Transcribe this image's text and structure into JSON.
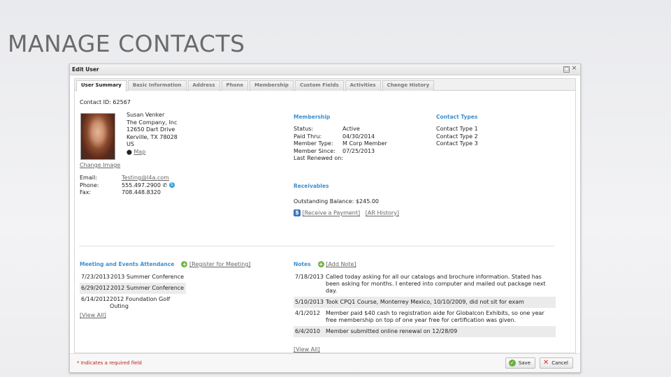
{
  "slide": {
    "title": "MANAGE CONTACTS"
  },
  "window": {
    "title": "Edit User",
    "minimize_glyph": "□",
    "close_glyph": "×"
  },
  "tabs": [
    {
      "label": "User Summary"
    },
    {
      "label": "Basic Information"
    },
    {
      "label": "Address"
    },
    {
      "label": "Phone"
    },
    {
      "label": "Membership"
    },
    {
      "label": "Custom Fields"
    },
    {
      "label": "Activities"
    },
    {
      "label": "Change History"
    }
  ],
  "contact": {
    "id_text": "Contact ID: 62567",
    "name": "Susan Venker",
    "company": "The Company, Inc",
    "street": "12650 Dart Drive",
    "city": "Kerville, TX 78028",
    "country": "US",
    "map_link": "Map",
    "change_image": "Change Image",
    "email_label": "Email:",
    "email": "Testing@l4a.com",
    "phone_label": "Phone:",
    "phone": "555.497.2900",
    "fax_label": "Fax:",
    "fax": "708.448.8320"
  },
  "membership": {
    "heading": "Membership",
    "rows": [
      {
        "label": "Status:",
        "value": "Active"
      },
      {
        "label": "Paid Thru:",
        "value": "04/30/2014"
      },
      {
        "label": "Member Type:",
        "value": "M Corp Member"
      },
      {
        "label": "Member Since:",
        "value": "07/25/2013"
      },
      {
        "label": "Last Renewed on:",
        "value": ""
      }
    ]
  },
  "contact_types": {
    "heading": "Contact Types",
    "items": [
      "Contact Type 1",
      "Contact Type 2",
      "Contact Type 3"
    ]
  },
  "receivables": {
    "heading": "Receivables",
    "balance": "Outstanding Balance: $245.00",
    "receive_payment": "[Receive a Payment]",
    "ar_history": "[AR History]"
  },
  "meetings": {
    "heading": "Meeting and Events Attendance",
    "register_link": "[Register for Meeting]",
    "rows": [
      {
        "date": "7/23/2013",
        "name": "2013 Summer Conference"
      },
      {
        "date": "6/29/2012",
        "name": "2012 Summer Conference"
      },
      {
        "date": "6/14/2012",
        "name": "2012 Foundation Golf Outing"
      }
    ],
    "view_all": "[View All]"
  },
  "notes": {
    "heading": "Notes",
    "add_link": "[Add Note]",
    "rows": [
      {
        "date": "7/18/2013",
        "text": "Called today asking for all our catalogs and brochure information. Stated has been asking for months. I entered into computer and mailed out package next day."
      },
      {
        "date": "5/10/2013",
        "text": "Took CPQ1 Course, Monterrey Mexico, 10/10/2009, did not sit for exam"
      },
      {
        "date": "4/1/2012",
        "text": "Member paid $40 cash to registration aide for Globalcon Exhibits, so one year free membership on top of one year free for certification was given."
      },
      {
        "date": "6/4/2010",
        "text": "Member submitted online renewal on 12/28/09"
      }
    ],
    "view_all": "[View All]"
  },
  "footer": {
    "required_note": "* Indicates a required field",
    "save_label": "Save",
    "cancel_label": "Cancel"
  },
  "colors": {
    "heading_blue": "#3d8fcf",
    "required_red": "#b3261e",
    "title_gray": "#6b6b6b"
  }
}
